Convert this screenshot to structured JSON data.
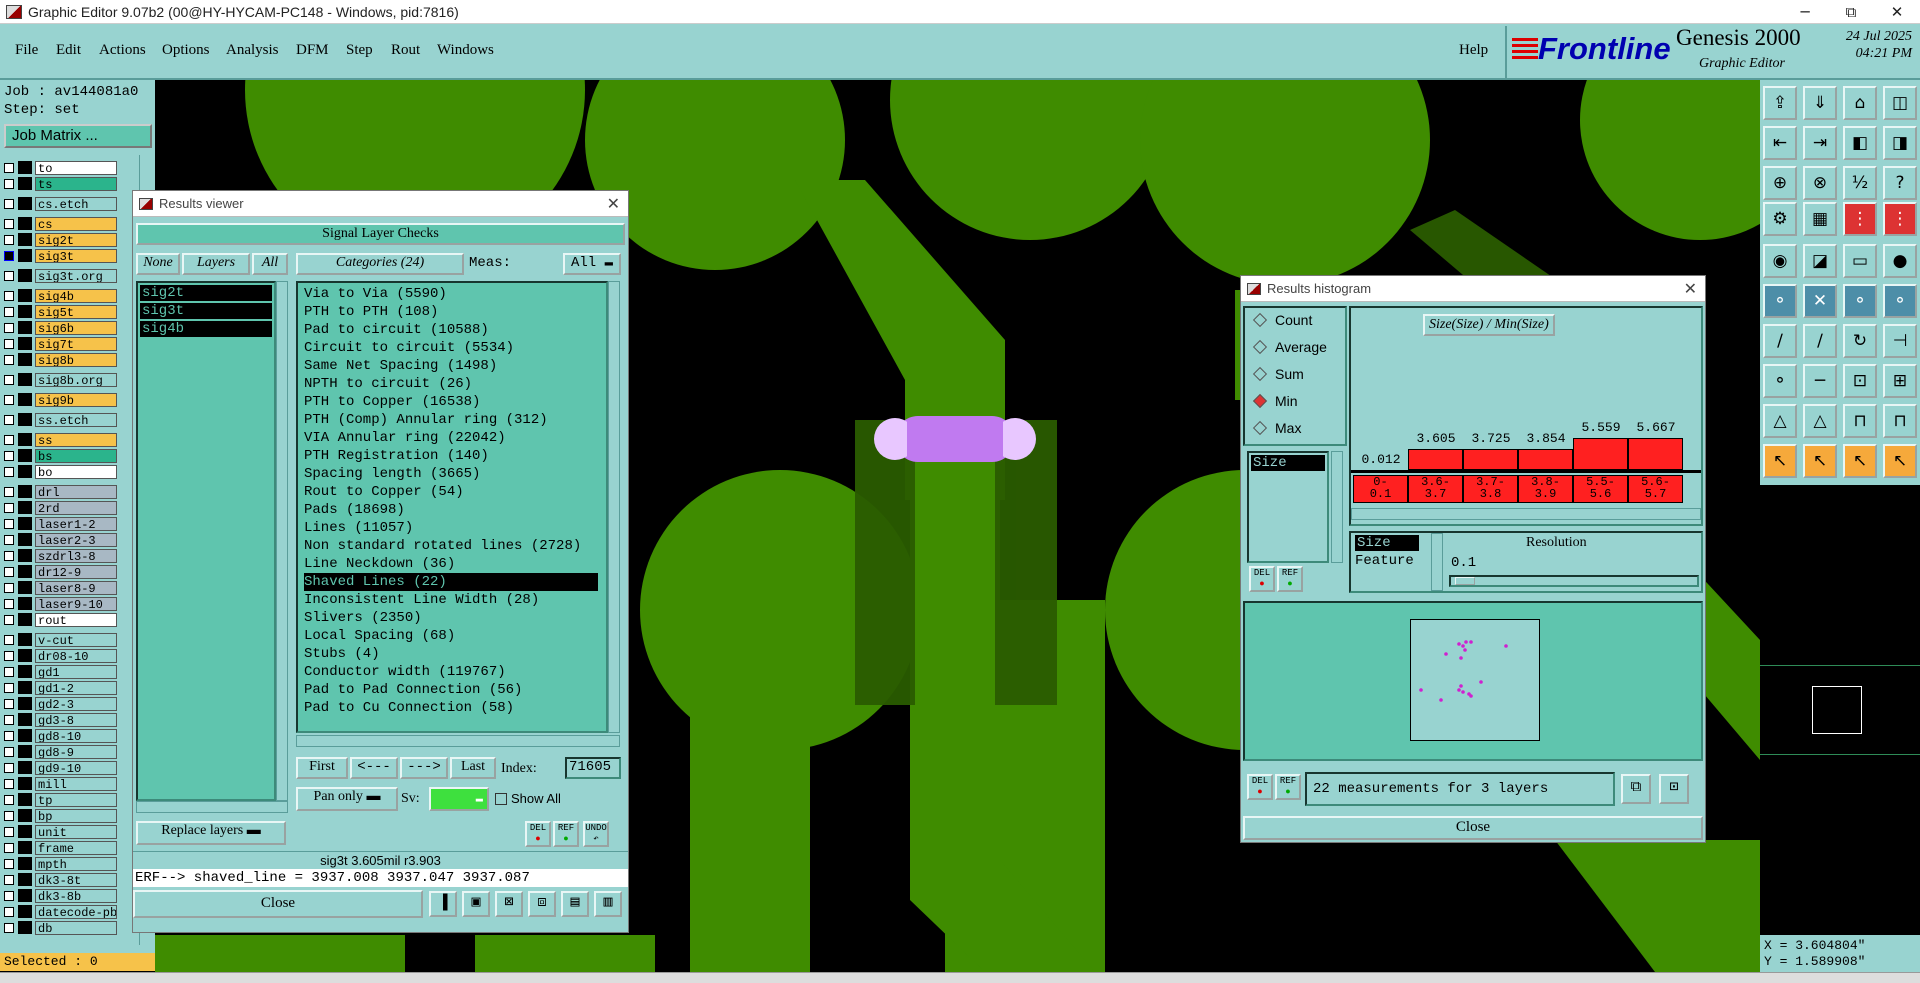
{
  "window": {
    "title": "Graphic Editor 9.07b2 (00@HY-HYCAM-PC148 - Windows, pid:7816)",
    "minimize": "─",
    "maximize": "⧉",
    "close": "✕"
  },
  "menu": {
    "items": [
      "File",
      "Edit",
      "Actions",
      "Options",
      "Analysis",
      "DFM",
      "Step",
      "Rout",
      "Windows"
    ],
    "help": "Help"
  },
  "branding": {
    "logo": "Frontline",
    "product": "Genesis 2000",
    "subtitle": "Graphic Editor",
    "date": "24 Jul 2025",
    "time": "04:21 PM"
  },
  "left_panel": {
    "job": "Job : av144081a0",
    "step": "Step: set",
    "job_matrix": "Job Matrix ...",
    "selected": "Selected : 0",
    "layers": [
      {
        "name": "to",
        "color": "white"
      },
      {
        "name": "ts",
        "color": "green"
      },
      {
        "name": "cs.etch",
        "color": "cyan"
      },
      {
        "name": "cs",
        "color": "yellow"
      },
      {
        "name": "sig2t",
        "color": "yellow"
      },
      {
        "name": "sig3t",
        "color": "yellow"
      },
      {
        "name": "sig3t.org",
        "color": "cyan"
      },
      {
        "name": "sig4b",
        "color": "yellow"
      },
      {
        "name": "sig5t",
        "color": "yellow"
      },
      {
        "name": "sig6b",
        "color": "yellow"
      },
      {
        "name": "sig7t",
        "color": "yellow"
      },
      {
        "name": "sig8b",
        "color": "yellow"
      },
      {
        "name": "sig8b.org",
        "color": "cyan"
      },
      {
        "name": "sig9b",
        "color": "yellow"
      },
      {
        "name": "ss.etch",
        "color": "cyan"
      },
      {
        "name": "ss",
        "color": "yellow"
      },
      {
        "name": "bs",
        "color": "green"
      },
      {
        "name": "bo",
        "color": "white"
      },
      {
        "name": "drl",
        "color": "gray"
      },
      {
        "name": "2rd",
        "color": "gray"
      },
      {
        "name": "laser1-2",
        "color": "gray"
      },
      {
        "name": "laser2-3",
        "color": "gray"
      },
      {
        "name": "szdrl3-8",
        "color": "gray"
      },
      {
        "name": "dr12-9",
        "color": "gray"
      },
      {
        "name": "laser8-9",
        "color": "gray"
      },
      {
        "name": "laser9-10",
        "color": "gray"
      },
      {
        "name": "rout",
        "color": "white"
      },
      {
        "name": "v-cut",
        "color": "cyan"
      },
      {
        "name": "dr08-10",
        "color": "cyan"
      },
      {
        "name": "gd1",
        "color": "cyan"
      },
      {
        "name": "gd1-2",
        "color": "cyan"
      },
      {
        "name": "gd2-3",
        "color": "cyan"
      },
      {
        "name": "gd3-8",
        "color": "cyan"
      },
      {
        "name": "gd8-10",
        "color": "cyan"
      },
      {
        "name": "gd8-9",
        "color": "cyan"
      },
      {
        "name": "gd9-10",
        "color": "cyan"
      },
      {
        "name": "mill",
        "color": "cyan"
      },
      {
        "name": "tp",
        "color": "cyan"
      },
      {
        "name": "bp",
        "color": "cyan"
      },
      {
        "name": "unit",
        "color": "cyan"
      },
      {
        "name": "frame",
        "color": "cyan"
      },
      {
        "name": "mpth",
        "color": "cyan"
      },
      {
        "name": "dk3-8t",
        "color": "cyan"
      },
      {
        "name": "dk3-8b",
        "color": "cyan"
      },
      {
        "name": "datecode-pb",
        "color": "cyan"
      },
      {
        "name": "db",
        "color": "cyan"
      }
    ]
  },
  "results_viewer": {
    "title": "Results viewer",
    "header": "Signal Layer Checks",
    "none": "None",
    "layers_label": "Layers",
    "all": "All",
    "categories_label": "Categories (24)",
    "meas_label": "Meas:",
    "meas_value": "All",
    "layer_list": [
      "sig2t",
      "sig3t",
      "sig4b"
    ],
    "categories": [
      "Via to Via (5590)",
      "PTH to PTH (108)",
      "Pad to circuit (10588)",
      "Circuit to circuit (5534)",
      "Same Net Spacing (1498)",
      "NPTH to circuit (26)",
      "PTH to Copper (16538)",
      "PTH (Comp) Annular ring (312)",
      "VIA Annular ring (22042)",
      "PTH Registration (140)",
      "Spacing length (3665)",
      "Rout to Copper (54)",
      "Pads (18698)",
      "Lines (11057)",
      "Non standard rotated lines (2728)",
      "Line Neckdown (36)",
      "Shaved Lines (22)",
      "Inconsistent Line Width (28)",
      "Slivers (2350)",
      "Local Spacing (68)",
      "Stubs (4)",
      "Conductor width (119767)",
      "Pad to Pad Connection (56)",
      "Pad to Cu Connection (58)"
    ],
    "selected_category_index": 16,
    "first": "First",
    "prev": "<---",
    "next": "--->",
    "last": "Last",
    "index_label": "Index:",
    "index_value": "71605",
    "pan_only": "Pan only",
    "sv_label": "Sv:",
    "show_all": "Show All",
    "replace_layers": "Replace layers",
    "del": "DEL",
    "ref": "REF",
    "undo": "UNDO",
    "status": "sig3t 3.605mil  r3.903",
    "erf": "ERF--> shaved_line = 3937.008 3937.047 3937.087",
    "close": "Close"
  },
  "histogram": {
    "title": "Results histogram",
    "options": [
      "Count",
      "Average",
      "Sum",
      "Min",
      "Max"
    ],
    "selected_option": "Min",
    "field_list": [
      "Size"
    ],
    "chart_title": "Size(Size) / Min(Size)",
    "axis_first_value": "0.012",
    "bars": [
      {
        "label": "0-\n0.1",
        "value": "0.012",
        "level": 0.0
      },
      {
        "label": "3.6-\n3.7",
        "value": "3.605",
        "level": 0.62
      },
      {
        "label": "3.7-\n3.8",
        "value": "3.725",
        "level": 0.62
      },
      {
        "label": "3.8-\n3.9",
        "value": "3.854",
        "level": 0.62
      },
      {
        "label": "5.5-\n5.6",
        "value": "5.559",
        "level": 0.95
      },
      {
        "label": "5.6-\n5.7",
        "value": "5.667",
        "level": 0.95
      }
    ],
    "size_label": "Size",
    "feature_label": "Feature",
    "resolution_label": "Resolution",
    "resolution_value": "0.1",
    "del": "DEL",
    "ref": "REF",
    "status": "22 measurements for 3 layers",
    "close": "Close"
  },
  "coords": {
    "x": "X = 3.604804\"",
    "y": "Y = 1.589908\""
  },
  "colors": {
    "copper": "#3f8c00",
    "panel": "#98d3d0",
    "list": "#5fc5ae",
    "highlight": "#c07af0"
  }
}
